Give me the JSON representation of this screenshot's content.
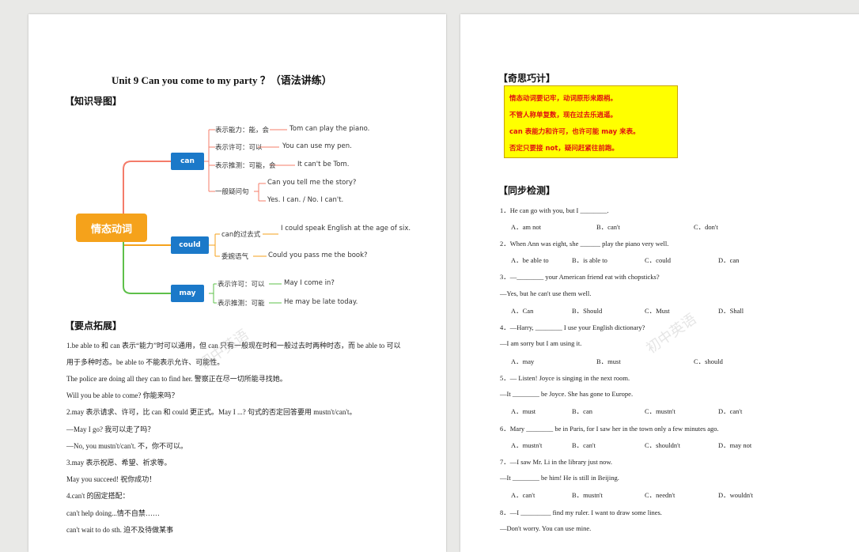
{
  "left_page": {
    "title": "Unit 9    Can you come to my party  ？（语法讲练）",
    "section_mindmap": "【知识导图】",
    "mindmap": {
      "root": "情态动词",
      "can": {
        "label": "can",
        "b1": "表示能力：能，会",
        "b1_ex": "Tom can play the piano.",
        "b2": "表示许可：可以",
        "b2_ex": "You can use my pen.",
        "b3": "表示推测：可能，会",
        "b3_ex": "It can't be Tom.",
        "b4": "一般疑问句",
        "b4_q": "Can you tell me the story?",
        "b4_a": "Yes. I can. / No. I can't."
      },
      "could": {
        "label": "could",
        "b1": "can的过去式",
        "b1_ex": "I could speak English at the age of six.",
        "b2": "委婉语气",
        "b2_ex": "Could you pass me the book?"
      },
      "may": {
        "label": "may",
        "b1": "表示许可：可以",
        "b1_ex": "May I come in?",
        "b2": "表示推测：可能",
        "b2_ex": "He may be late today."
      }
    },
    "section_points": "【要点拓展】",
    "points": [
      "1.be able to 和 can 表示“能力”时可以通用，但 can 只有一般现在时和一般过去时两种时态，而 be able to 可以",
      "用于多种时态。be able to 不能表示允许、可能性。",
      "The police are doing all they can to find her. 警察正在尽一切所能寻找她。",
      "Will you be able to come? 你能来吗？",
      "2.may 表示请求、许可，比 can 和 could 更正式。May I ...? 句式的否定回答要用 mustn't/can't。",
      "—May I go? 我可以走了吗？",
      "—No, you mustn't/can't. 不，你不可以。",
      "3.may 表示祝愿、希望、祈求等。",
      "May you succeed! 祝你成功！",
      "4.can't 的固定搭配：",
      "can't help doing...情不自禁……",
      "can't wait to do sth. 迫不及待做某事"
    ]
  },
  "right_page": {
    "section_tips": "【奇思巧计】",
    "tips": [
      "情态动词要记牢，动词原形来跟梢。",
      "不管人称单复数，现在过去乐逍遥。",
      "can 表能力和许可，也许可能 may 来表。",
      "否定只要接 not，疑问赶紧往前跑。"
    ],
    "section_test": "【同步检测】",
    "questions": [
      {
        "lines": [
          "1．He can go with you, but I ________."
        ],
        "options": [
          "A．am not",
          "B．can't",
          "C．don't"
        ]
      },
      {
        "lines": [
          "2．When Ann was eight, she ______ play the piano very well."
        ],
        "options": [
          "A．be able to",
          "B．is able to",
          "C．could",
          "D．can"
        ]
      },
      {
        "lines": [
          "3．—________ your American friend eat with chopsticks?",
          "—Yes, but he can't use them well."
        ],
        "options": [
          "A．Can",
          "B．Should",
          "C．Must",
          "D．Shall"
        ]
      },
      {
        "lines": [
          "4．—Harry, ________ I use your English dictionary?",
          "—I am sorry but I am using it."
        ],
        "options": [
          "A．may",
          "B．must",
          "C．should"
        ]
      },
      {
        "lines": [
          "5．— Listen! Joyce is singing in the next room.",
          "—It ________ be Joyce. She has gone to Europe."
        ],
        "options": [
          "A．must",
          "B．can",
          "C．mustn't",
          "D．can't"
        ]
      },
      {
        "lines": [
          "6．Mary ________ be in Paris, for I saw her in the town only a few minutes ago."
        ],
        "options": [
          "A．mustn't",
          "B．can't",
          "C．shouldn't",
          "D．may not"
        ]
      },
      {
        "lines": [
          "7．—I saw Mr. Li in the library just now.",
          "—It ________ be him! He is still in Beijing."
        ],
        "options": [
          "A．can't",
          "B．mustn't",
          "C．needn't",
          "D．wouldn't"
        ]
      },
      {
        "lines": [
          "8．—I _________ find my ruler. I want to draw some lines.",
          "—Don't worry. You can use mine."
        ],
        "options": []
      }
    ]
  },
  "colors": {
    "can_branch": "#f47c6a",
    "could_branch": "#f5a21b",
    "may_branch": "#5ec04a",
    "node_blue": "#1b79c9",
    "root": "#f5a21b"
  }
}
